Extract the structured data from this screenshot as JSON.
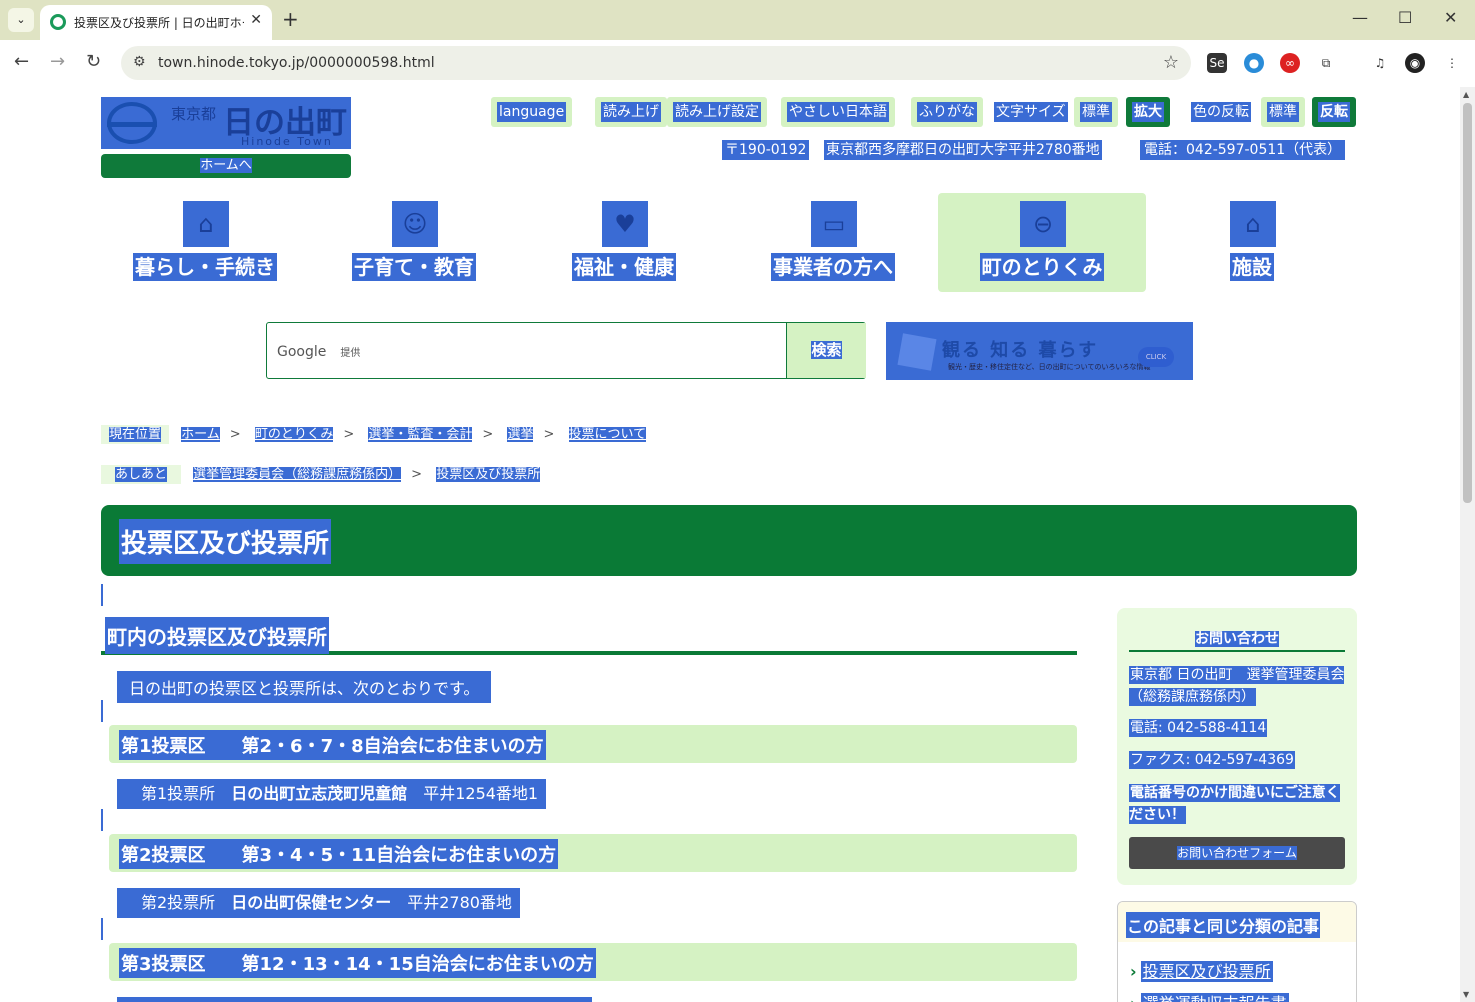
{
  "browser": {
    "tab_title": "投票区及び投票所 | 日の出町ホー",
    "url": "town.hinode.tokyo.jp/0000000598.html"
  },
  "header": {
    "logo_pref": "東京都",
    "logo_town": "日の出町",
    "logo_en": "Hinode Town",
    "home_label": "ホームへ",
    "utility": {
      "language": "language",
      "read_aloud": "読み上げ",
      "read_settings": "読み上げ設定",
      "easy_japanese": "やさしい日本語",
      "furigana": "ふりがな",
      "font_size": "文字サイズ",
      "font_standard": "標準",
      "font_large": "拡大",
      "color_invert": "色の反転",
      "color_standard": "標準",
      "color_reverse": "反転"
    },
    "postal": "〒190-0192",
    "address": "東京都西多摩郡日の出町大字平井2780番地",
    "phone": "電話：042-597-0511（代表）"
  },
  "global_nav": [
    {
      "label": "暮らし・手続き",
      "icon": "house-icon"
    },
    {
      "label": "子育て・教育",
      "icon": "child-face-icon"
    },
    {
      "label": "福祉・健康",
      "icon": "heart-hand-icon"
    },
    {
      "label": "事業者の方へ",
      "icon": "briefcase-icon"
    },
    {
      "label": "町のとりくみ",
      "icon": "town-emblem-icon"
    },
    {
      "label": "施設",
      "icon": "building-icon"
    }
  ],
  "search": {
    "placeholder_brand": "Google",
    "placeholder_suffix": "提供",
    "button": "検索"
  },
  "banner": {
    "text": "観る 知る 暮らす",
    "sub": "観光・歴史・移住定住など、日の出町についてのいろいろな情報",
    "click": "CLICK"
  },
  "breadcrumb": {
    "label": "現在位置",
    "items": [
      "ホーム",
      "町のとりくみ",
      "選挙・監査・会計",
      "選挙",
      "投票について"
    ]
  },
  "footprint": {
    "label": "あしあと",
    "items": [
      "選挙管理委員会（総務課庶務係内）",
      "投票区及び投票所"
    ]
  },
  "main": {
    "title": "投票区及び投票所",
    "section_title": "町内の投票区及び投票所",
    "lead": "日の出町の投票区と投票所は、次のとおりです。",
    "districts": [
      {
        "heading": "第1投票区　　第2・6・7・8自治会にお住まいの方",
        "place_prefix": "第1投票所　",
        "place_name": "日の出町立志茂町児童館",
        "place_addr": "　平井1254番地1"
      },
      {
        "heading": "第2投票区　　第3・4・5・11自治会にお住まいの方",
        "place_prefix": "第2投票所　",
        "place_name": "日の出町保健センター",
        "place_addr": "　平井2780番地"
      },
      {
        "heading": "第3投票区　　第12・13・14・15自治会にお住まいの方"
      }
    ]
  },
  "contact": {
    "heading": "お問い合わせ",
    "org": "東京都 日の出町　選挙管理委員会（総務課庶務係内）",
    "tel": "電話: 042-588-4114",
    "fax": "ファクス: 042-597-4369",
    "note": "電話番号のかけ間違いにご注意ください！",
    "form_button": "お問い合わせフォーム"
  },
  "related": {
    "heading": "この記事と同じ分類の記事",
    "items": [
      "投票区及び投票所",
      "選挙運動収支報告書"
    ]
  },
  "colors": {
    "brand_green": "#0a7a36",
    "light_green": "#d5f2c3",
    "selection_blue": "#3a6bd4"
  }
}
